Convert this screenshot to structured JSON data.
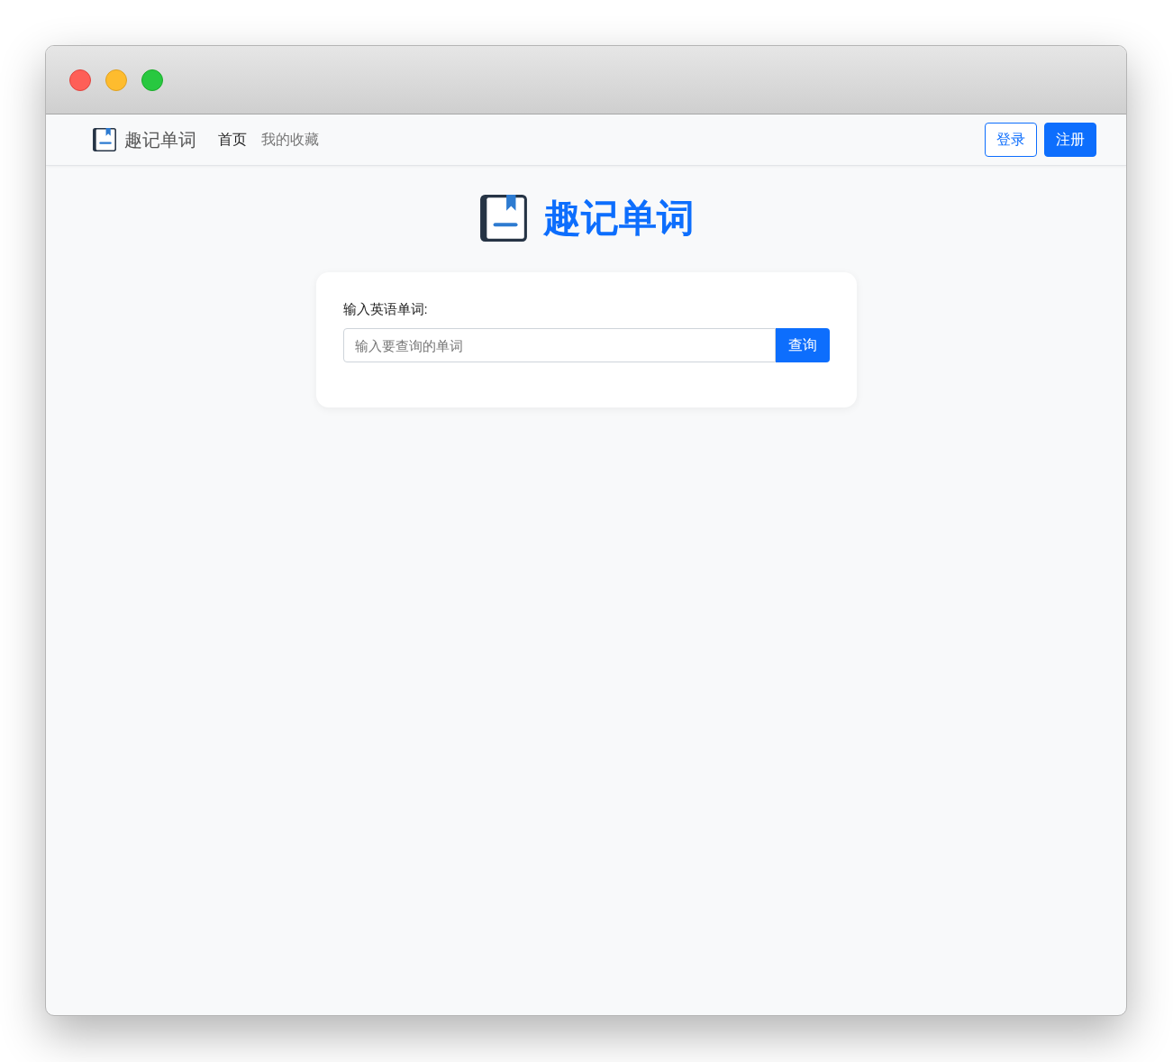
{
  "navbar": {
    "brand": "趣记单词",
    "links": [
      {
        "label": "首页",
        "selected": true
      },
      {
        "label": "我的收藏",
        "selected": false
      }
    ],
    "buttons": [
      {
        "label": "登录",
        "kind": "outline"
      },
      {
        "label": "注册",
        "kind": "primary"
      }
    ]
  },
  "heading": "趣记单词",
  "search_card": {
    "label": "输入英语单词:",
    "placeholder": "输入要查询的单词",
    "button": "查询"
  }
}
